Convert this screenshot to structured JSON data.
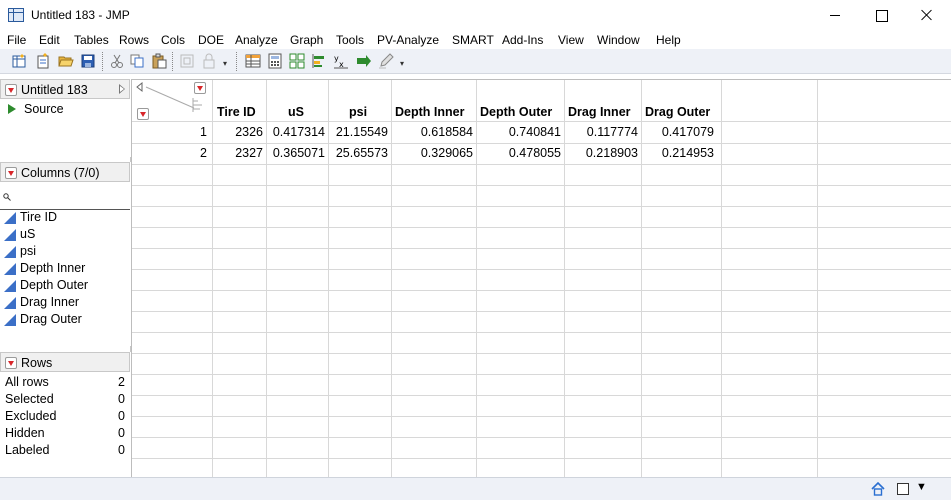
{
  "window": {
    "title": "Untitled 183 - JMP"
  },
  "menu": [
    "File",
    "Edit",
    "Tables",
    "Rows",
    "Cols",
    "DOE",
    "Analyze",
    "Graph",
    "Tools",
    "PV-Analyze",
    "SMART",
    "Add-Ins",
    "View",
    "Window",
    "Help"
  ],
  "toolbar": {
    "icons": [
      "new-table-icon",
      "new-script-icon",
      "open-icon",
      "save-icon",
      "cut-icon",
      "copy-icon",
      "paste-icon",
      "disabled-icon-1",
      "disabled-icon-2",
      "data-table-icon",
      "calculator-icon",
      "grid-layout-icon",
      "bar-align-icon",
      "formula-xy-icon",
      "arrow-run-icon",
      "pencil-icon"
    ]
  },
  "table_panel": {
    "title": "Untitled 183",
    "source": "Source"
  },
  "columns_panel": {
    "title": "Columns (7/0)",
    "search_placeholder": "",
    "items": [
      "Tire ID",
      "uS",
      "psi",
      "Depth Inner",
      "Depth Outer",
      "Drag Inner",
      "Drag Outer"
    ]
  },
  "rows_panel": {
    "title": "Rows",
    "stats": [
      {
        "label": "All rows",
        "value": "2"
      },
      {
        "label": "Selected",
        "value": "0"
      },
      {
        "label": "Excluded",
        "value": "0"
      },
      {
        "label": "Hidden",
        "value": "0"
      },
      {
        "label": "Labeled",
        "value": "0"
      }
    ]
  },
  "table": {
    "headers": [
      "Tire ID",
      "uS",
      "psi",
      "Depth Inner",
      "Depth Outer",
      "Drag Inner",
      "Drag Outer"
    ],
    "rows": [
      {
        "num": "1",
        "cells": [
          "2326",
          "0.417314",
          "21.15549",
          "0.618584",
          "0.740841",
          "0.117774",
          "0.417079"
        ]
      },
      {
        "num": "2",
        "cells": [
          "2327",
          "0.365071",
          "25.65573",
          "0.329065",
          "0.478055",
          "0.218903",
          "0.214953"
        ]
      }
    ]
  }
}
